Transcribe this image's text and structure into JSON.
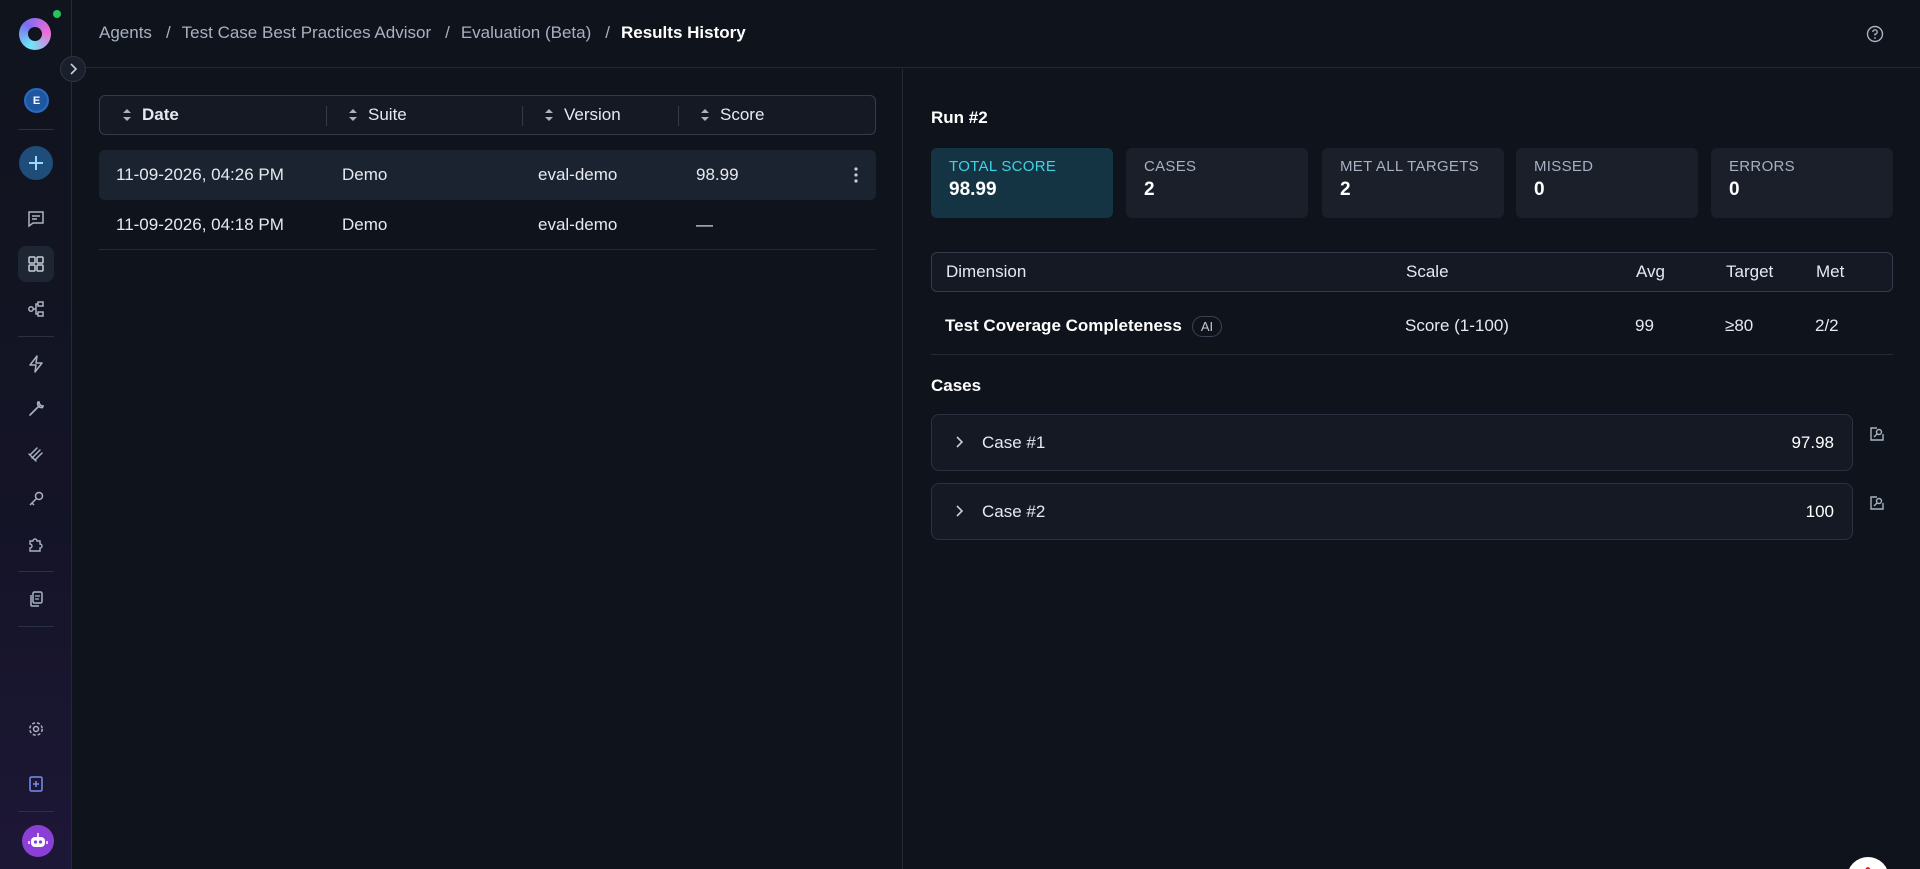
{
  "sidebar": {
    "avatar_initial": "E",
    "icons": [
      "chat-icon",
      "dashboard-icon",
      "workflow-icon",
      "lightning-icon",
      "wrench-icon",
      "layers-icon",
      "key-icon",
      "puzzle-icon",
      "documents-icon",
      "settings-icon",
      "notebook-icon",
      "bot-icon"
    ]
  },
  "header": {
    "breadcrumb": [
      "Agents",
      "Test Case Best Practices Advisor",
      "Evaluation (Beta)",
      "Results History"
    ]
  },
  "history": {
    "columns": [
      "Date",
      "Suite",
      "Version",
      "Score"
    ],
    "rows": [
      {
        "date": "11-09-2026, 04:26 PM",
        "suite": "Demo",
        "version": "eval-demo",
        "score": "98.99"
      },
      {
        "date": "11-09-2026, 04:18 PM",
        "suite": "Demo",
        "version": "eval-demo",
        "score": "—"
      }
    ]
  },
  "run": {
    "title": "Run #2",
    "stats": [
      {
        "label": "TOTAL SCORE",
        "value": "98.99"
      },
      {
        "label": "CASES",
        "value": "2"
      },
      {
        "label": "MET ALL TARGETS",
        "value": "2"
      },
      {
        "label": "MISSED",
        "value": "0"
      },
      {
        "label": "ERRORS",
        "value": "0"
      }
    ],
    "dimension_columns": [
      "Dimension",
      "Scale",
      "Avg",
      "Target",
      "Met"
    ],
    "dimensions": [
      {
        "name": "Test Coverage Completeness",
        "badge": "AI",
        "scale": "Score (1-100)",
        "avg": "99",
        "target": "≥80",
        "met": "2/2"
      }
    ],
    "cases_title": "Cases",
    "cases": [
      {
        "name": "Case #1",
        "score": "97.98"
      },
      {
        "name": "Case #2",
        "score": "100"
      }
    ]
  },
  "colors": {
    "background": "#0f131c",
    "accent": "#43d1e6",
    "highlight_card": "#153443",
    "bot_button": "#8b3fd6"
  }
}
